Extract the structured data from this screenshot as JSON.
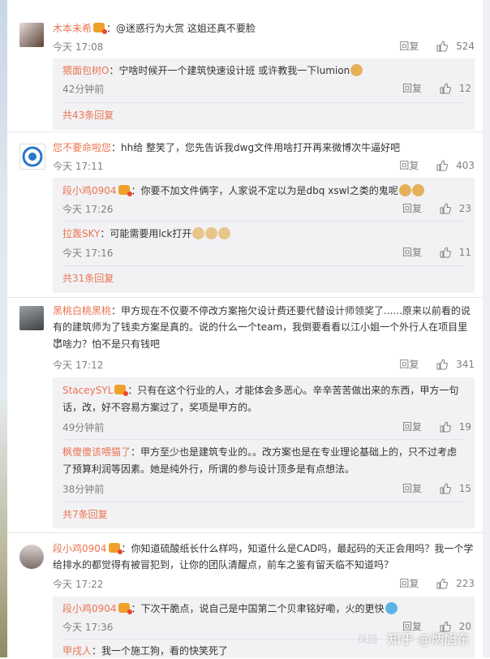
{
  "comments": [
    {
      "user": "木本未希",
      "text": "：@迷惑行为大赏 这姐还真不要脸",
      "time": "今天 17:08",
      "reply": "回复",
      "likes": "524",
      "replies": [
        {
          "user": "猥面包树O",
          "text": "：宁啥时候开一个建筑快速设计班 或许教我一下lumion",
          "time": "42分钟前",
          "reply": "回复",
          "likes": "12"
        }
      ],
      "more": "共43条回复"
    },
    {
      "user": "您不要命啦您",
      "text": "：hh给  整笑了，您先告诉我dwg文件用啥打开再来微博次牛逼好吧",
      "time": "今天 17:11",
      "reply": "回复",
      "likes": "403",
      "replies": [
        {
          "user": "段小鸡0904",
          "text": "：你要不加文件俩字，人家说不定以为是dbq xswl之类的鬼呢",
          "time": "今天 17:26",
          "reply": "回复",
          "likes": "23"
        },
        {
          "user": "拉轰SKY",
          "text": "：可能需要用lck打开",
          "time": "今天 17:16",
          "reply": "回复",
          "likes": "11"
        }
      ],
      "more": "共31条回复"
    },
    {
      "user": "黑桃白桃黑桃",
      "text_lines": [
        "：甲方现在不仅要不停改方案拖欠设计费还要代替设计师领奖了......原来以前看的说",
        "有的建筑师为了钱卖方案是真的。说的什么一个team，我倒要看看以江小姐一个外行人在项目里出",
        "了啥力？怕不是只有钱吧"
      ],
      "time": "今天 17:12",
      "reply": "回复",
      "likes": "341",
      "replies": [
        {
          "user": "StaceySYL",
          "text_lines": [
            "：只有在这个行业的人，才能体会多恶心。辛辛苦苦做出来的东西，甲方一句",
            "话，改，好不容易方案过了，奖项是甲方的。"
          ],
          "time": "49分钟前",
          "reply": "回复",
          "likes": "19"
        },
        {
          "user": "枫傻傻该喂猫了",
          "text_lines": [
            "：甲方至少也是建筑专业的。。改方案也是在专业理论基础上的，只不过考虑",
            "了预算利润等因素。她是纯外行，所谓的参与设计顶多是有点想法。"
          ],
          "time": "38分钟前",
          "reply": "回复",
          "likes": "15"
        }
      ],
      "more": "共7条回复"
    },
    {
      "user": "段小鸡0904",
      "text_lines": [
        "：你知道硫酸纸长什么样吗，知道什么是CAD吗，最起码的天正会用吗？我一个学",
        "给排水的都觉得有被冒犯到，让你的团队清醒点，前车之鉴有留天临不知道吗？"
      ],
      "time": "今天 17:22",
      "reply": "回复",
      "likes": "223",
      "replies": [
        {
          "user": "段小鸡0904",
          "text": "：下次干脆点，说自己是中国第二个贝聿铭好嘞，火的更快",
          "time": "今天 17:36",
          "reply": "回复",
          "likes": "20"
        },
        {
          "user": "甲戌人",
          "text": "：我一个施工狗，看的快笑死了"
        }
      ]
    }
  ],
  "watermark": "知乎 @炳旭东",
  "watermark2": "凤回"
}
